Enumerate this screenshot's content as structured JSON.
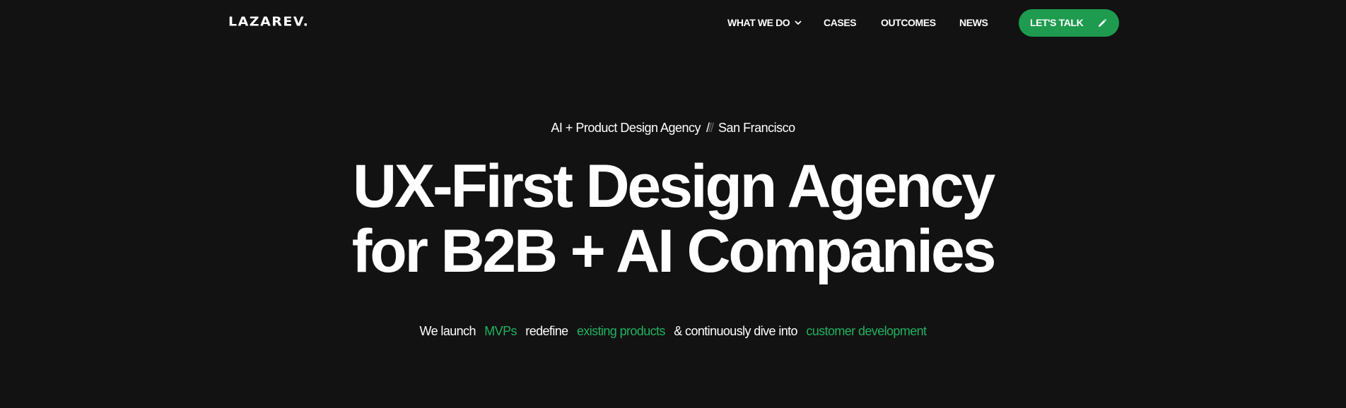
{
  "brand": {
    "logo": "LAZAREV.",
    "accent_color": "#1e9b4f",
    "highlight_color": "#22b15f",
    "background_color": "#121212"
  },
  "nav": {
    "items": [
      {
        "label": "WHAT WE DO",
        "icon": "chevron-down-icon"
      },
      {
        "label": "CASES"
      },
      {
        "label": "OUTCOMES"
      },
      {
        "label": "NEWS"
      }
    ],
    "cta": {
      "label": "LET'S TALK",
      "icon": "pencil-icon"
    }
  },
  "hero": {
    "eyebrow": {
      "left": "AI + Product Design Agency",
      "separator_bright": "/",
      "separator_dim": "//",
      "right": "San Francisco"
    },
    "headline": {
      "line1": "UX-First Design Agency",
      "line2": "for B2B + AI Companies"
    },
    "subline": {
      "part1": "We launch",
      "highlight1": "MVPs",
      "part2": "redefine",
      "highlight2": "existing products",
      "part3": "& continuously dive into",
      "highlight3": "customer development"
    }
  }
}
